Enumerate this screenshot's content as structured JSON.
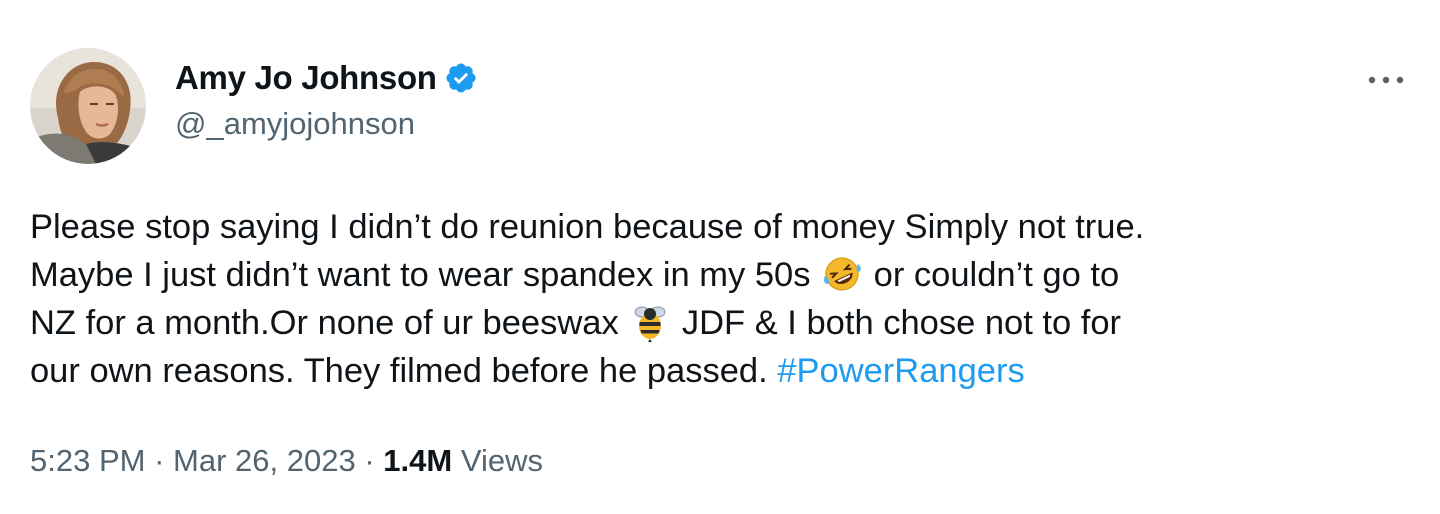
{
  "author": {
    "display_name": "Amy Jo Johnson",
    "handle": "@_amyjojohnson",
    "verified": true,
    "avatar_icon": "profile-photo"
  },
  "more_button": {
    "icon": "more-horizontal-icon"
  },
  "tweet": {
    "lines": [
      {
        "text": "Please stop saying I didn’t do reunion because of money Simply not true."
      },
      {
        "before": "Maybe I just didn’t want to wear spandex in my 50s",
        "emoji": "rolling-on-the-floor-laughing-emoji",
        "after": "or couldn’t go to"
      },
      {
        "before": "NZ for a month.Or none of ur beeswax",
        "emoji": "bee-emoji",
        "after": "JDF & I both chose not to for"
      },
      {
        "before": "our own reasons. They filmed before he passed.",
        "hashtag": "#PowerRangers"
      }
    ]
  },
  "meta": {
    "time": "5:23 PM",
    "separator": "·",
    "date": "Mar 26, 2023",
    "views_count": "1.4M",
    "views_label": "Views"
  },
  "colors": {
    "text_primary": "#0f1419",
    "text_secondary": "#536471",
    "link": "#1d9bf0",
    "verified_badge": "#1d9bf0"
  }
}
